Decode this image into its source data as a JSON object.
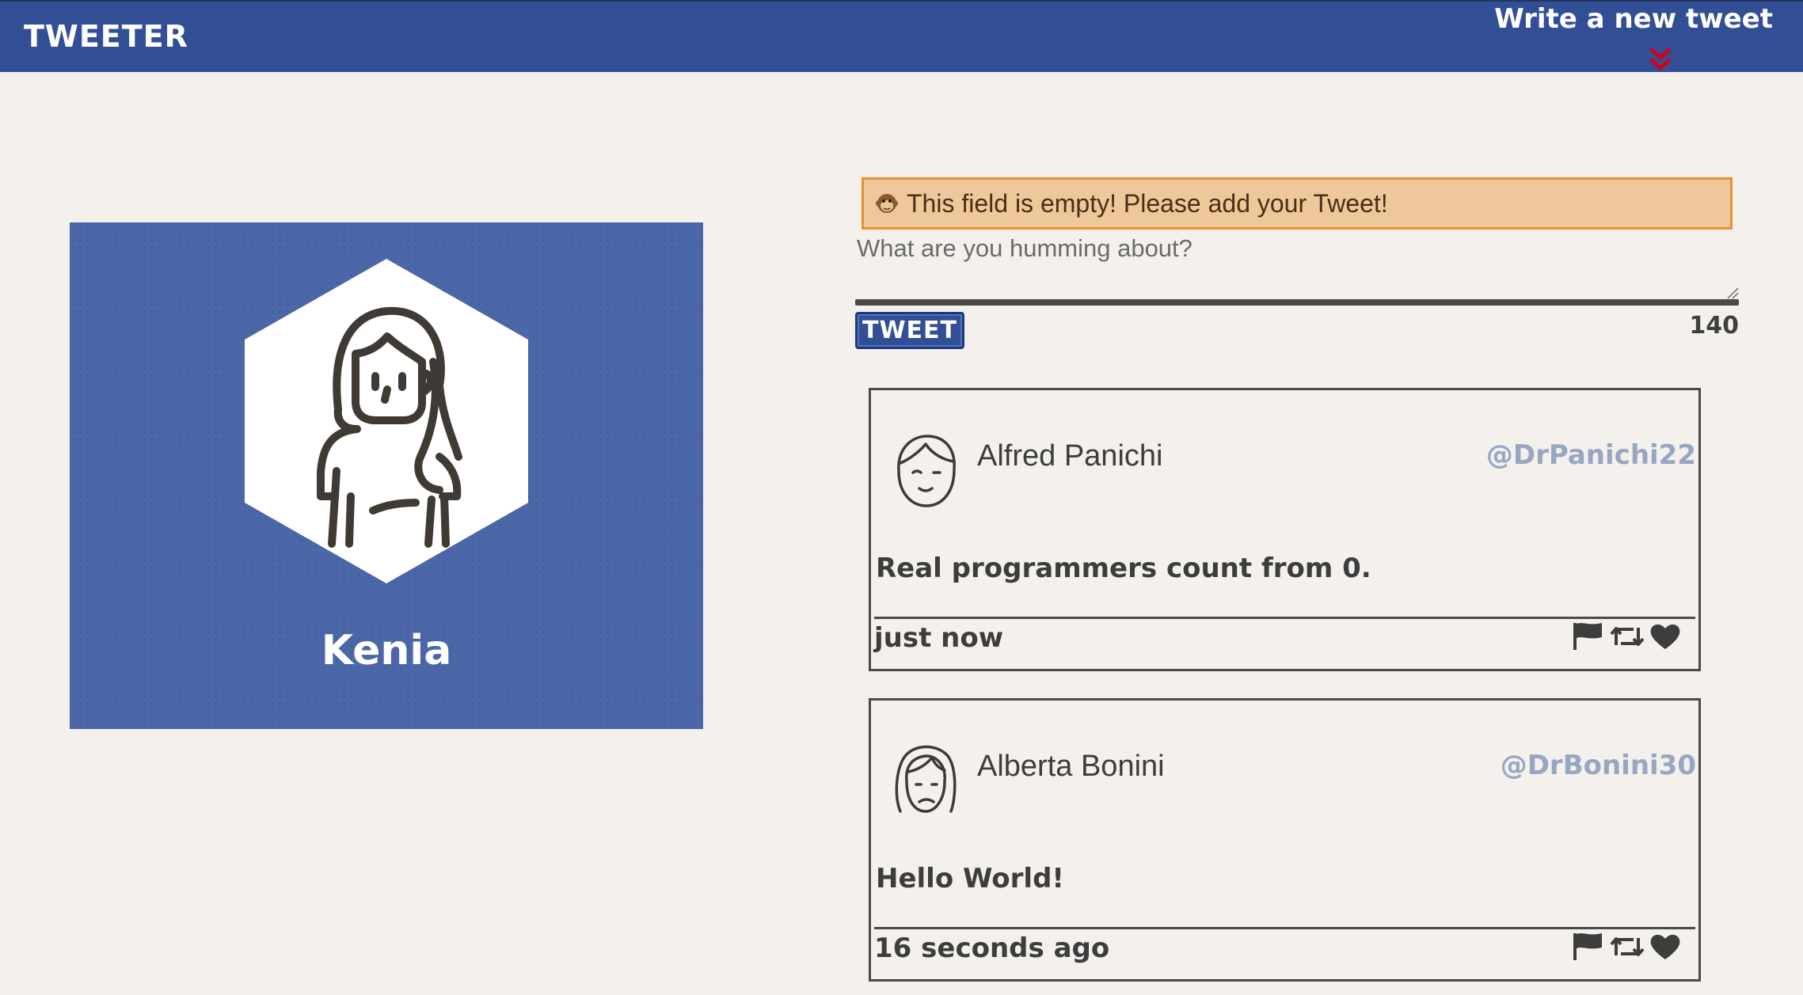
{
  "nav": {
    "brand": "TWEETER",
    "compose_label": "Write a new tweet",
    "compose_icon": "double-chevron-down-icon",
    "accent": "#324f96",
    "chevron_color": "#d0021b"
  },
  "profile": {
    "name": "Kenia",
    "avatar_icon": "woman-avatar-icon",
    "background": "#4c67a8"
  },
  "composer": {
    "error_icon": "monkey-icon",
    "error_message": "This field is empty! Please add your Tweet!",
    "placeholder": "What are you humming about?",
    "value": "",
    "submit_label": "TWEET",
    "counter": "140"
  },
  "tweets": [
    {
      "name": "Alfred Panichi",
      "handle": "@DrPanichi22",
      "content": "Real programmers count from 0.",
      "timestamp": "just now",
      "avatar_icon": "man-avatar-icon"
    },
    {
      "name": "Alberta Bonini",
      "handle": "@DrBonini30",
      "content": "Hello World!",
      "timestamp": "16 seconds ago",
      "avatar_icon": "woman-avatar-icon"
    }
  ],
  "tweet_actions": [
    "flag-icon",
    "retweet-icon",
    "heart-icon"
  ]
}
